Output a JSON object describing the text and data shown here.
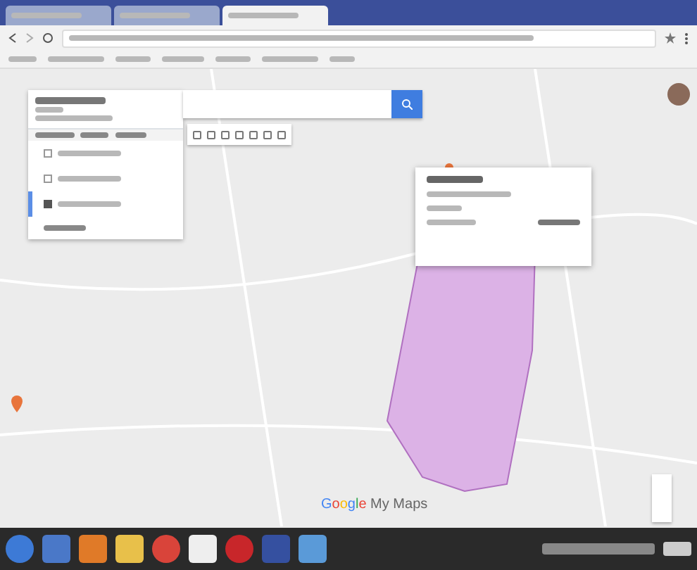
{
  "browser": {
    "tabs": [
      {
        "selected": false
      },
      {
        "selected": false
      },
      {
        "selected": true
      }
    ]
  },
  "sidebar": {
    "layers": [
      {
        "checked": false,
        "selected": false
      },
      {
        "checked": false,
        "selected": false
      },
      {
        "checked": true,
        "selected": true
      }
    ]
  },
  "map": {
    "logo": "Google My Maps"
  }
}
